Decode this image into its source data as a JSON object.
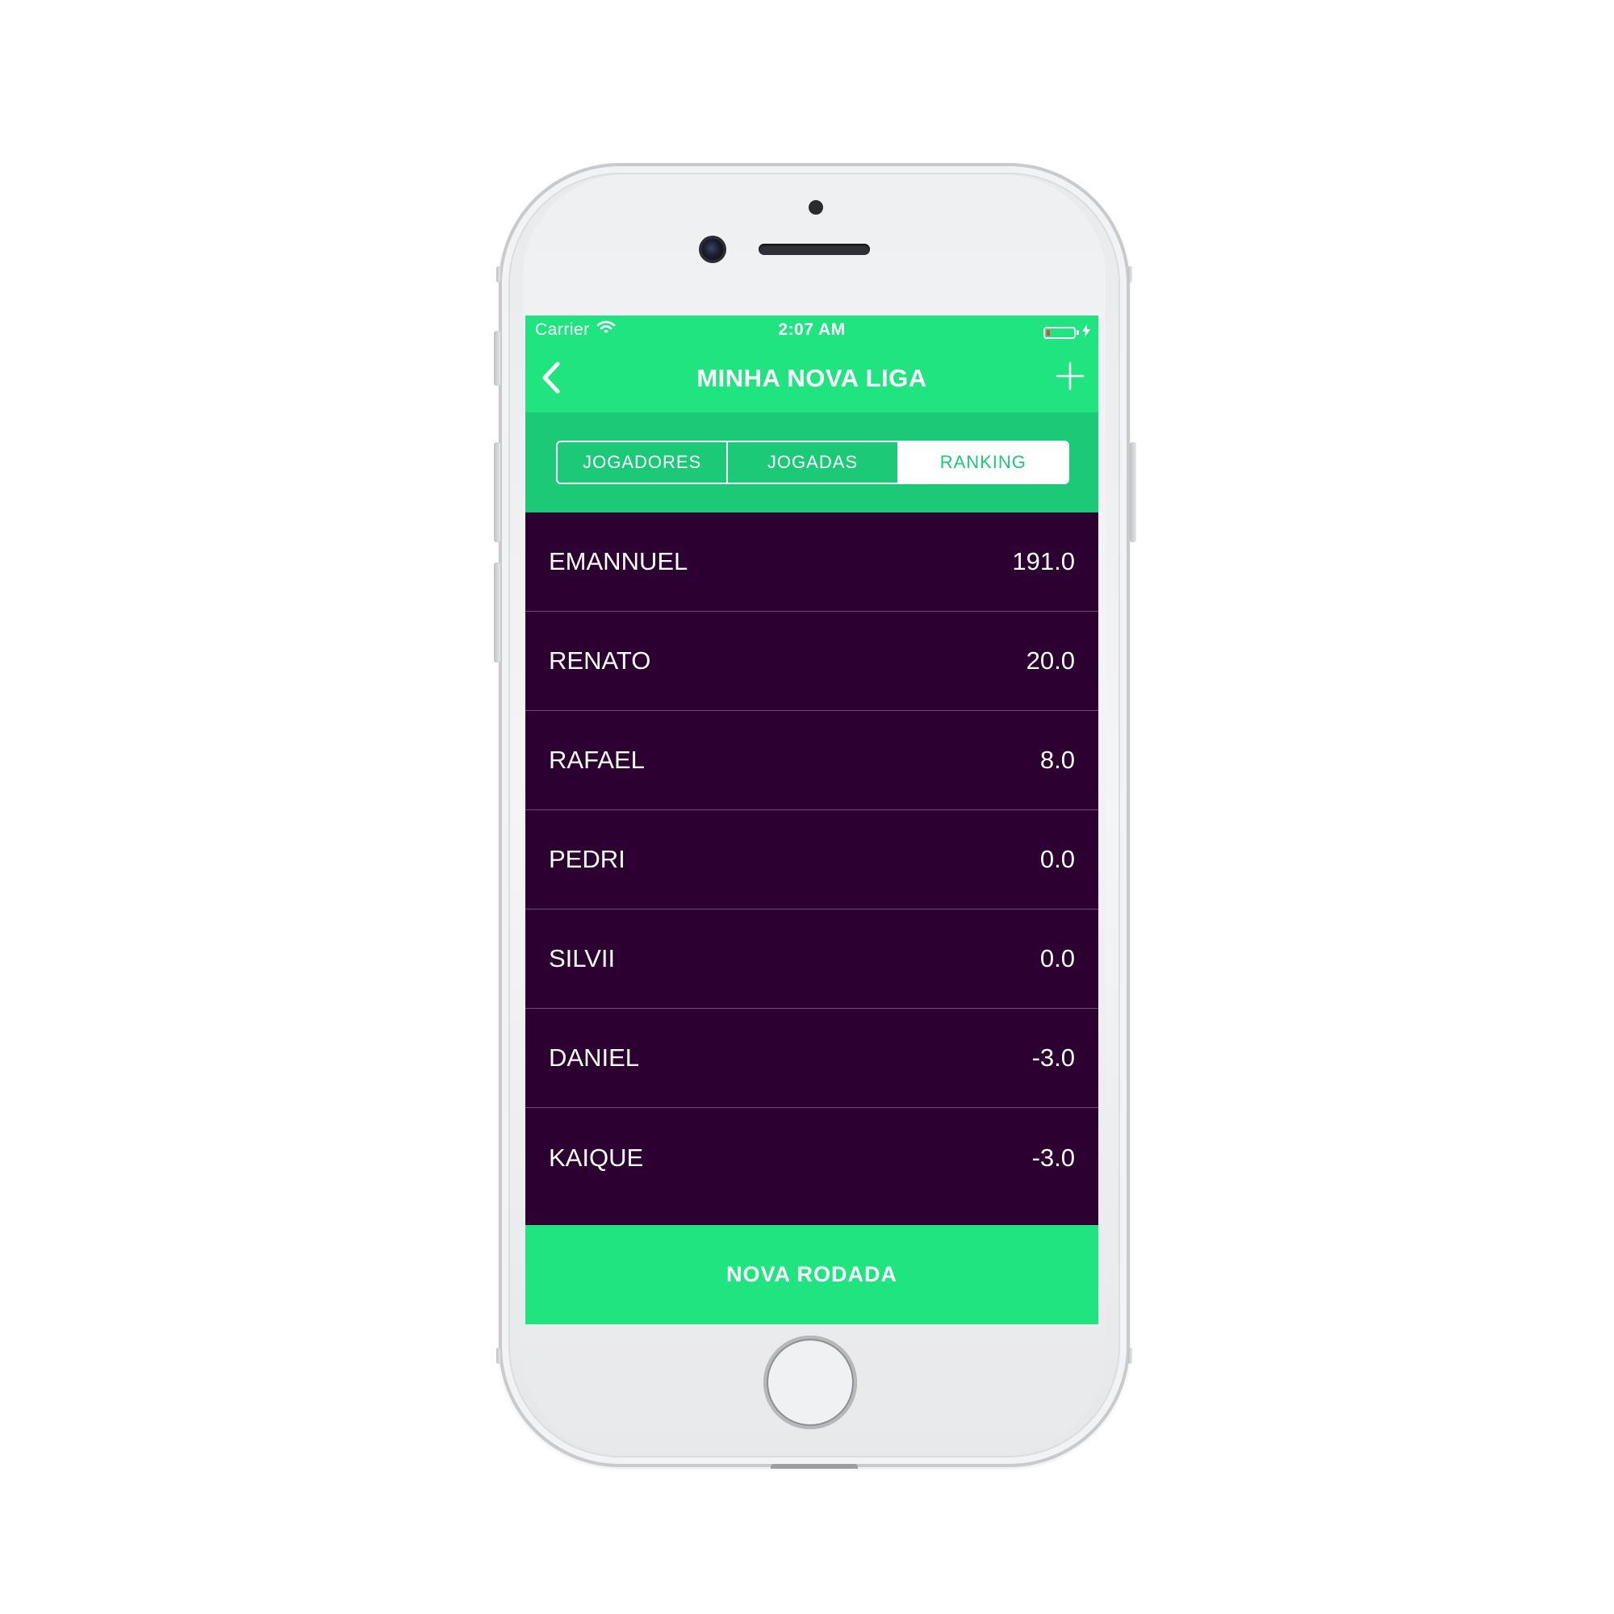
{
  "status_bar": {
    "carrier": "Carrier",
    "time": "2:07 AM",
    "wifi_icon": "wifi-icon",
    "battery_icon": "battery-low-icon",
    "charging_icon": "lightning-icon"
  },
  "nav": {
    "title": "MINHA NOVA LIGA",
    "back_icon": "chevron-left-icon",
    "add_icon": "plus-icon"
  },
  "tabs": [
    {
      "label": "JOGADORES",
      "active": false
    },
    {
      "label": "JOGADAS",
      "active": false
    },
    {
      "label": "RANKING",
      "active": true
    }
  ],
  "ranking": [
    {
      "name": "EMANNUEL",
      "score": "191.0"
    },
    {
      "name": "RENATO",
      "score": "20.0"
    },
    {
      "name": "RAFAEL",
      "score": "8.0"
    },
    {
      "name": "PEDRI",
      "score": "0.0"
    },
    {
      "name": "SILVII",
      "score": "0.0"
    },
    {
      "name": "DANIEL",
      "score": "-3.0"
    },
    {
      "name": "KAIQUE",
      "score": "-3.0"
    }
  ],
  "footer": {
    "button_label": "NOVA RODADA"
  },
  "colors": {
    "accent_green": "#1fe47f",
    "segment_green": "#1bc977",
    "list_background": "#2c0030",
    "battery_low": "#ff3b30"
  }
}
